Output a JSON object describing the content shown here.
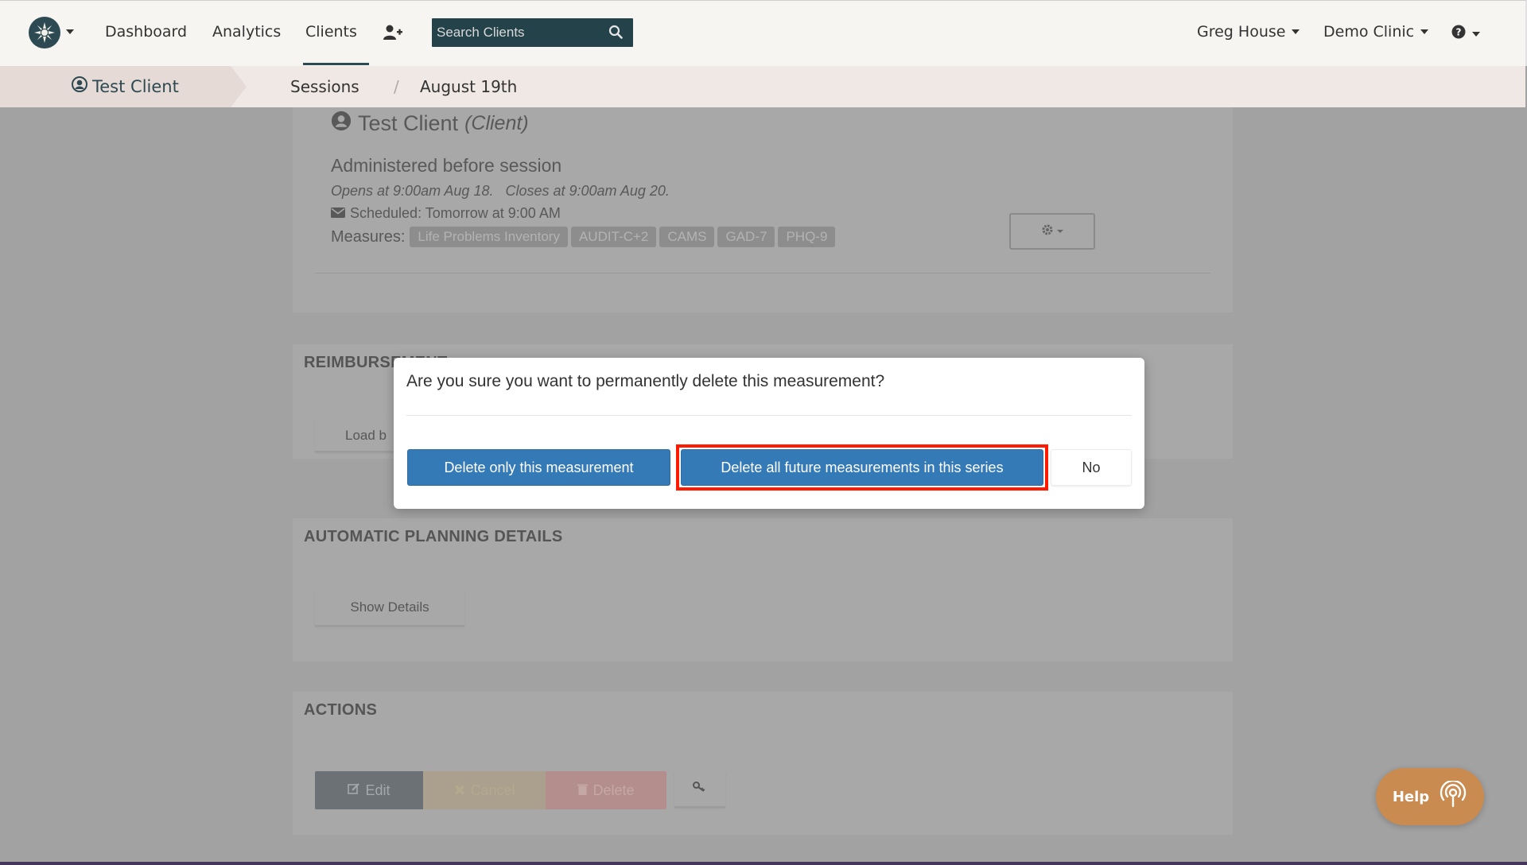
{
  "navbar": {
    "links": [
      "Dashboard",
      "Analytics",
      "Clients"
    ],
    "active_link": "Clients",
    "search_placeholder": "Search Clients",
    "user_name": "Greg House",
    "clinic_name": "Demo Clinic"
  },
  "breadcrumb": {
    "client": "Test Client",
    "sessions": "Sessions",
    "separator": "/",
    "date": "August 19th"
  },
  "measurement": {
    "client_name": "Test Client",
    "client_role": "(Client)",
    "administered": "Administered before session",
    "window": "Opens at 9:00am Aug 18.   Closes at 9:00am Aug 20.",
    "scheduled": "Scheduled: Tomorrow at 9:00 AM",
    "measures_label": "Measures:",
    "measures": [
      "Life Problems Inventory",
      "AUDIT-C+2",
      "CAMS",
      "GAD-7",
      "PHQ-9"
    ]
  },
  "reimbursement": {
    "title": "REIMBURSEMENT",
    "load_button": "Load b"
  },
  "planning": {
    "title": "AUTOMATIC PLANNING DETAILS",
    "show_button": "Show Details"
  },
  "actions": {
    "title": "ACTIONS",
    "edit": "Edit",
    "cancel": "Cancel",
    "delete": "Delete"
  },
  "modal": {
    "question": "Are you sure you want to permanently delete this measurement?",
    "delete_one": "Delete only this measurement",
    "delete_future": "Delete all future measurements in this series",
    "no": "No"
  },
  "help": {
    "label": "Help"
  },
  "colors": {
    "brand": "#2d4a52",
    "primary": "#337ab7",
    "highlight": "#ff1a00",
    "help": "#c98b4f"
  }
}
